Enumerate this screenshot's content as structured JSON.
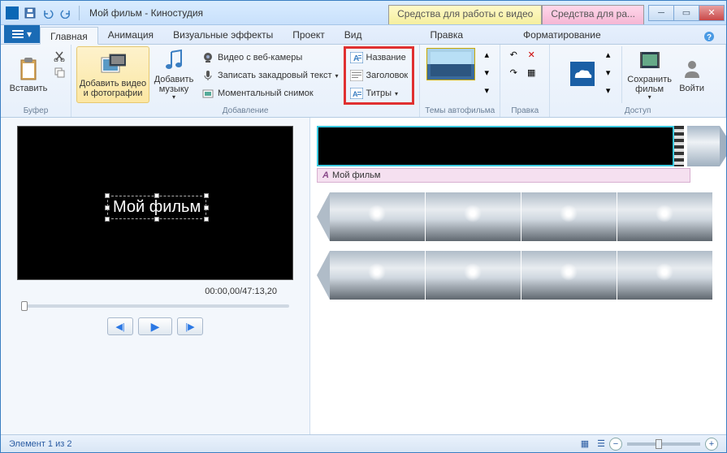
{
  "title": "Мой фильм - Киностудия",
  "contextual": {
    "video": "Средства для работы с видео",
    "text": "Средства для ра..."
  },
  "tabs": {
    "home": "Главная",
    "animation": "Анимация",
    "effects": "Визуальные эффекты",
    "project": "Проект",
    "view": "Вид",
    "edit": "Правка",
    "format": "Форматирование"
  },
  "groups": {
    "clipboard": "Буфер",
    "add": "Добавление",
    "themes": "Темы автофильма",
    "editing": "Правка",
    "access": "Доступ"
  },
  "buttons": {
    "paste": "Вставить",
    "add_media": "Добавить видео и фотографии",
    "add_music": "Добавить музыку",
    "webcam": "Видео с веб-камеры",
    "voiceover": "Записать закадровый текст",
    "snapshot": "Моментальный снимок",
    "title": "Название",
    "caption": "Заголовок",
    "credits": "Титры",
    "save_movie": "Сохранить фильм",
    "signin": "Войти"
  },
  "preview": {
    "title_text": "Мой фильм",
    "time": "00:00,00/47:13,20"
  },
  "timeline": {
    "title_label": "Мой фильм"
  },
  "status": {
    "text": "Элемент 1 из 2"
  }
}
